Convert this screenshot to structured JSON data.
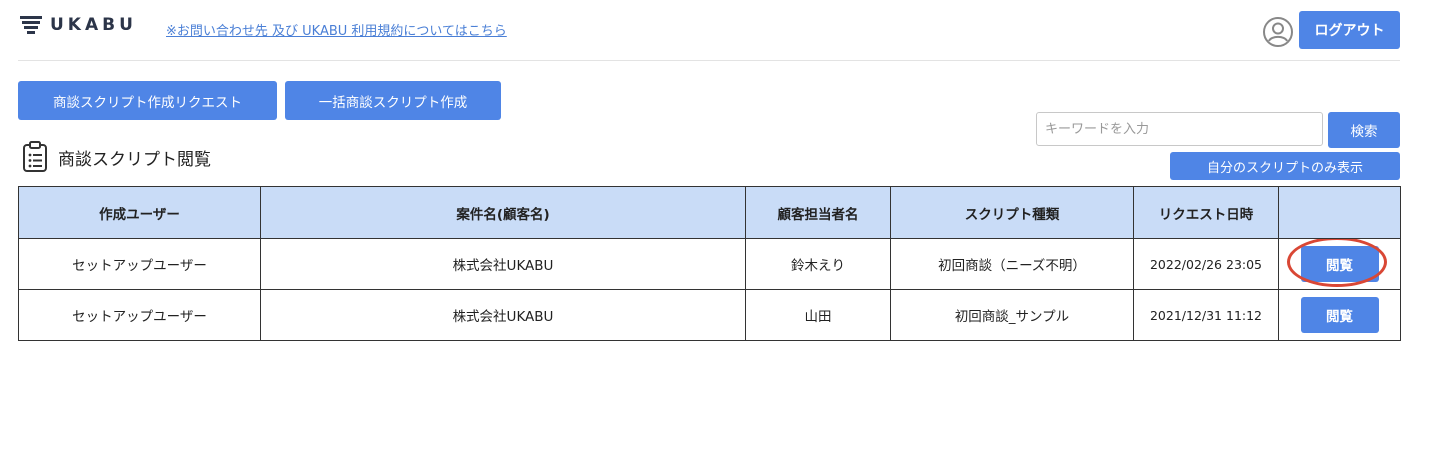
{
  "header": {
    "logo_text": "UKABU",
    "contact_link": "※お問い合わせ先 及び UKABU 利用規約についてはこちら",
    "logout_label": "ログアウト"
  },
  "actions": {
    "request_label": "商談スクリプト作成リクエスト",
    "bulk_label": "一括商談スクリプト作成"
  },
  "section": {
    "title": "商談スクリプト閲覧"
  },
  "search": {
    "placeholder": "キーワードを入力",
    "value": "",
    "button_label": "検索",
    "mine_only_label": "自分のスクリプトのみ表示"
  },
  "table": {
    "columns": [
      "作成ユーザー",
      "案件名(顧客名)",
      "顧客担当者名",
      "スクリプト種類",
      "リクエスト日時",
      ""
    ],
    "rows": [
      {
        "user": "セットアップユーザー",
        "project": "株式会社UKABU",
        "contact": "鈴木えり",
        "script_type": "初回商談（ニーズ不明）",
        "requested_at": "2022/02/26 23:05",
        "view_label": "閲覧",
        "highlighted": true
      },
      {
        "user": "セットアップユーザー",
        "project": "株式会社UKABU",
        "contact": "山田",
        "script_type": "初回商談_サンプル",
        "requested_at": "2021/12/31 11:12",
        "view_label": "閲覧",
        "highlighted": false
      }
    ]
  },
  "colors": {
    "accent": "#4f85e6",
    "table_header_bg": "#c9dcf7",
    "highlight_ring": "#d94735",
    "link": "#4a7fd6"
  }
}
